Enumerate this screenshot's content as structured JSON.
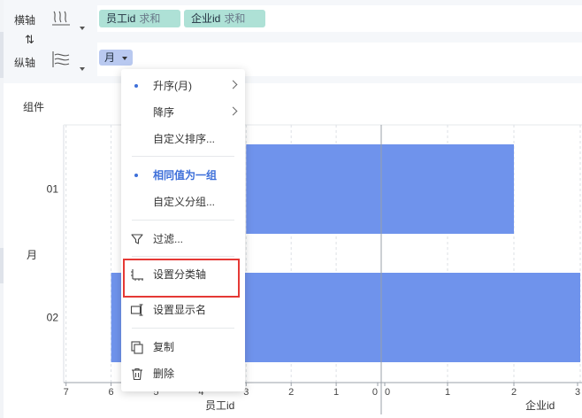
{
  "shelves": {
    "horizontal": {
      "label": "横轴",
      "pills": [
        {
          "field": "员工id",
          "agg": "求和"
        },
        {
          "field": "企业id",
          "agg": "求和"
        }
      ]
    },
    "vertical": {
      "label": "纵轴",
      "pills": [
        {
          "field": "月"
        }
      ]
    }
  },
  "component": {
    "title": "组件"
  },
  "chart_data": {
    "type": "bar",
    "orientation": "horizontal",
    "ylabel": "月",
    "categories": [
      "01",
      "02"
    ],
    "panels": [
      {
        "xlabel": "员工id",
        "direction": "reversed",
        "ticks": [
          "7",
          "6",
          "5",
          "4",
          "3",
          "2",
          "1",
          "0"
        ],
        "xlim": [
          0,
          7
        ],
        "values": [
          3,
          6
        ]
      },
      {
        "xlabel": "企业id",
        "ticks": [
          "0",
          "1",
          "2",
          "3"
        ],
        "xlim": [
          0,
          3
        ],
        "values": [
          2,
          3
        ]
      }
    ],
    "bar_color": "#6f93ec",
    "grid": true
  },
  "menu": {
    "items": [
      {
        "label": "升序(月)",
        "selected": true,
        "submenu": true
      },
      {
        "label": "降序",
        "selected": false,
        "submenu": true
      },
      {
        "label": "自定义排序..."
      },
      {
        "label": "相同值为一组",
        "selected": true,
        "bold": true
      },
      {
        "label": "自定义分组..."
      },
      {
        "label": "过滤...",
        "icon": "filter-icon"
      },
      {
        "label": "设置分类轴",
        "icon": "category-axis-icon",
        "highlighted": true
      },
      {
        "label": "设置显示名",
        "icon": "rename-icon"
      },
      {
        "label": "复制",
        "icon": "copy-icon"
      },
      {
        "label": "删除",
        "icon": "trash-icon"
      }
    ]
  },
  "colors": {
    "accent": "#3d6fd9",
    "bar": "#6f93ec",
    "pill_green": "#aee1d6",
    "pill_blue": "#b9c9f0",
    "highlight": "#e53935"
  }
}
